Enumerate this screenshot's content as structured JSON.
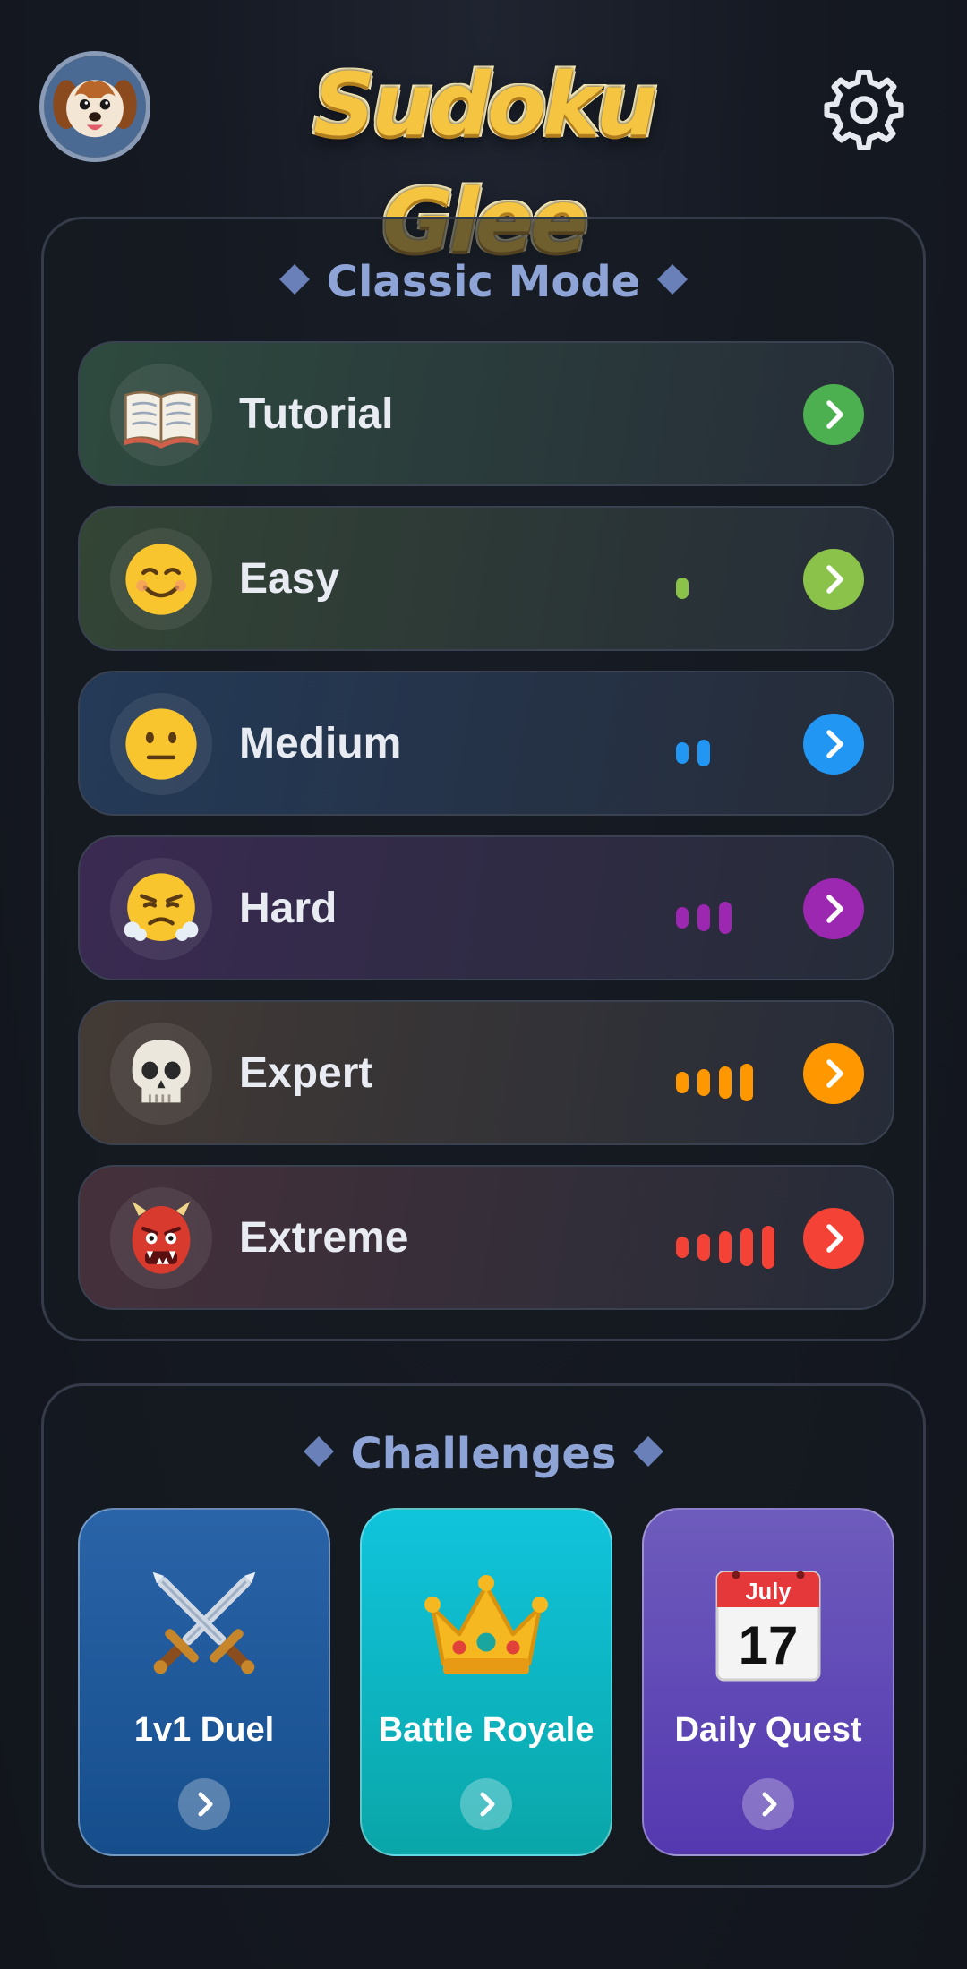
{
  "app": {
    "title": "Sudoku Glee"
  },
  "classic": {
    "title": "Classic Mode",
    "modes": [
      {
        "label": "Tutorial",
        "icon": "open-book-icon",
        "difficulty_level": 0,
        "accent": "#4caf50",
        "tint": "#2e4a3e"
      },
      {
        "label": "Easy",
        "icon": "smiling-face-icon",
        "difficulty_level": 1,
        "accent": "#8bc34a",
        "tint": "#334535"
      },
      {
        "label": "Medium",
        "icon": "neutral-face-icon",
        "difficulty_level": 2,
        "accent": "#2196f3",
        "tint": "#243a58"
      },
      {
        "label": "Hard",
        "icon": "steaming-face-icon",
        "difficulty_level": 3,
        "accent": "#9c27b0",
        "tint": "#3a2a52"
      },
      {
        "label": "Expert",
        "icon": "skull-icon",
        "difficulty_level": 4,
        "accent": "#ff9800",
        "tint": "#433a35"
      },
      {
        "label": "Extreme",
        "icon": "ogre-mask-icon",
        "difficulty_level": 5,
        "accent": "#f44336",
        "tint": "#45303a"
      }
    ]
  },
  "challenges": {
    "title": "Challenges",
    "cards": [
      {
        "label": "1v1 Duel",
        "icon": "crossed-swords-icon",
        "color_top": "#2a64a8",
        "color_bottom": "#164e8c"
      },
      {
        "label": "Battle Royale",
        "icon": "crown-icon",
        "color_top": "#10c4dc",
        "color_bottom": "#0aa6a8"
      },
      {
        "label": "Daily Quest",
        "icon": "calendar-icon",
        "calendar_month": "July",
        "calendar_day": "17",
        "color_top": "#6e5cbc",
        "color_bottom": "#5438b0"
      }
    ]
  }
}
